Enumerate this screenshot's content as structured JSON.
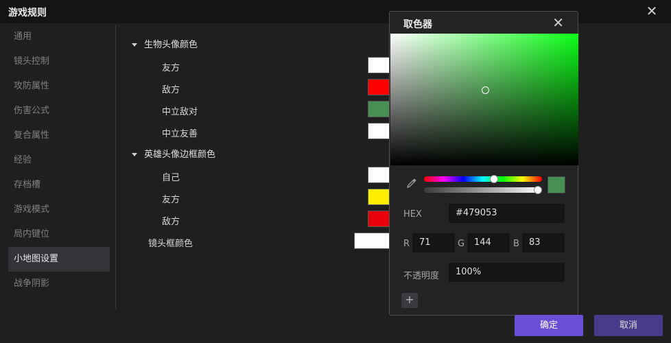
{
  "window": {
    "title": "游戏规则",
    "close_icon": "close-icon"
  },
  "sidebar": {
    "items": [
      {
        "label": "通用"
      },
      {
        "label": "镜头控制"
      },
      {
        "label": "攻防属性"
      },
      {
        "label": "伤害公式"
      },
      {
        "label": "复合属性"
      },
      {
        "label": "经验"
      },
      {
        "label": "存档槽"
      },
      {
        "label": "游戏模式"
      },
      {
        "label": "局内键位"
      },
      {
        "label": "小地图设置",
        "active": true
      },
      {
        "label": "战争阴影"
      }
    ]
  },
  "settings": {
    "group1": {
      "label": "生物头像颜色",
      "rows": [
        {
          "label": "友方",
          "color": "#ffffff"
        },
        {
          "label": "敌方",
          "color": "#ff0000"
        },
        {
          "label": "中立敌对",
          "color": "#479053"
        },
        {
          "label": "中立友善",
          "color": "#ffffff"
        }
      ]
    },
    "group2": {
      "label": "英雄头像边框颜色",
      "rows": [
        {
          "label": "自己",
          "color": "#ffffff"
        },
        {
          "label": "友方",
          "color": "#ffee00"
        },
        {
          "label": "敌方",
          "color": "#e8000c"
        }
      ]
    },
    "camera_frame": {
      "label": "镜头框颜色",
      "color": "#ffffff"
    }
  },
  "picker": {
    "title": "取色器",
    "hex_label": "HEX",
    "hex_value": "#479053",
    "r_label": "R",
    "r_value": "71",
    "g_label": "G",
    "g_value": "144",
    "b_label": "B",
    "b_value": "83",
    "opacity_label": "不透明度",
    "opacity_value": "100%",
    "add_label": "+",
    "preview_color": "#479053",
    "hue_level": 0.6,
    "alpha_level": 1.0
  },
  "footer": {
    "ok_label": "确定",
    "cancel_label": "取消"
  }
}
